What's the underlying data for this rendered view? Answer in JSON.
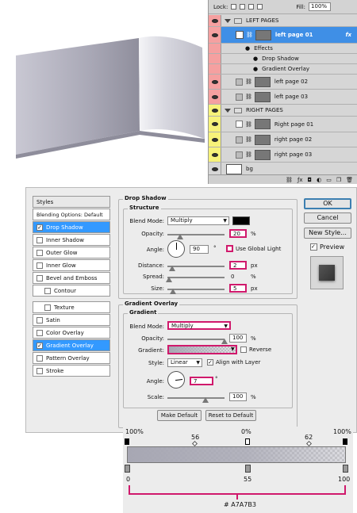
{
  "layers_panel": {
    "lock_label": "Lock:",
    "fill_label": "Fill:",
    "fill_value": "100%",
    "layers": [
      {
        "name": "LEFT PAGES",
        "kind": "group"
      },
      {
        "name": "left page 01",
        "kind": "layer",
        "selected": true,
        "fx": "fx"
      },
      {
        "name": "Effects",
        "kind": "effects"
      },
      {
        "name": "Drop Shadow",
        "kind": "effect"
      },
      {
        "name": "Gradient Overlay",
        "kind": "effect"
      },
      {
        "name": "left page 02",
        "kind": "layer"
      },
      {
        "name": "left page 03",
        "kind": "layer"
      },
      {
        "name": "RIGHT PAGES",
        "kind": "group"
      },
      {
        "name": "Right page 01",
        "kind": "layer"
      },
      {
        "name": "right page 02",
        "kind": "layer"
      },
      {
        "name": "right page 03",
        "kind": "layer"
      },
      {
        "name": "bg",
        "kind": "layer"
      }
    ],
    "colors": {
      "red": "#f5a0a0",
      "yellow": "#f7f27a",
      "selected": "#3f8fe6"
    }
  },
  "dialog": {
    "styles_header": "Styles",
    "blending_options": "Blending Options: Default",
    "style_list_top": [
      {
        "label": "Drop Shadow",
        "checked": true,
        "selected": true
      },
      {
        "label": "Inner Shadow",
        "checked": false
      },
      {
        "label": "Outer Glow",
        "checked": false
      },
      {
        "label": "Inner Glow",
        "checked": false
      },
      {
        "label": "Bevel and Emboss",
        "checked": false
      },
      {
        "label": "Contour",
        "checked": false
      }
    ],
    "style_list_bottom": [
      {
        "label": "Texture",
        "checked": false
      },
      {
        "label": "Satin",
        "checked": false
      },
      {
        "label": "Color Overlay",
        "checked": false
      },
      {
        "label": "Gradient Overlay",
        "checked": true,
        "selected": true
      },
      {
        "label": "Pattern Overlay",
        "checked": false
      },
      {
        "label": "Stroke",
        "checked": false
      }
    ],
    "buttons": {
      "ok": "OK",
      "cancel": "Cancel",
      "new_style": "New Style...",
      "preview": "Preview",
      "make_default": "Make Default",
      "reset_default": "Reset to Default"
    },
    "drop_shadow": {
      "title": "Drop Shadow",
      "structure": "Structure",
      "blend_mode_label": "Blend Mode:",
      "blend_mode": "Multiply",
      "opacity_label": "Opacity:",
      "opacity": "20",
      "angle_label": "Angle:",
      "angle": "90",
      "global_light": "Use Global Light",
      "distance_label": "Distance:",
      "distance": "2",
      "spread_label": "Spread:",
      "spread": "0",
      "size_label": "Size:",
      "size": "5",
      "pct": "%",
      "px": "px",
      "deg": "°"
    },
    "gradient_overlay": {
      "title": "Gradient Overlay",
      "gradient": "Gradient",
      "blend_mode_label": "Blend Mode:",
      "blend_mode": "Multiply",
      "opacity_label": "Opacity:",
      "opacity": "100",
      "gradient_label": "Gradient:",
      "reverse": "Reverse",
      "style_label": "Style:",
      "style": "Linear",
      "align": "Align with Layer",
      "angle_label": "Angle:",
      "angle": "7",
      "scale_label": "Scale:",
      "scale": "100",
      "pct": "%",
      "deg": "°"
    }
  },
  "gradient_editor": {
    "opacity_stops": [
      {
        "label": "100%",
        "location": 0
      },
      {
        "label": "0%",
        "location": 55
      },
      {
        "label": "100%",
        "location": 100
      }
    ],
    "midpoints": [
      {
        "label": "56",
        "location": 28
      },
      {
        "label": "62",
        "location": 80
      }
    ],
    "color_stops": [
      {
        "label": "0",
        "location": 0
      },
      {
        "label": "55",
        "location": 55
      },
      {
        "label": "100",
        "location": 100
      }
    ],
    "color_hex": "# A7A7B3"
  }
}
